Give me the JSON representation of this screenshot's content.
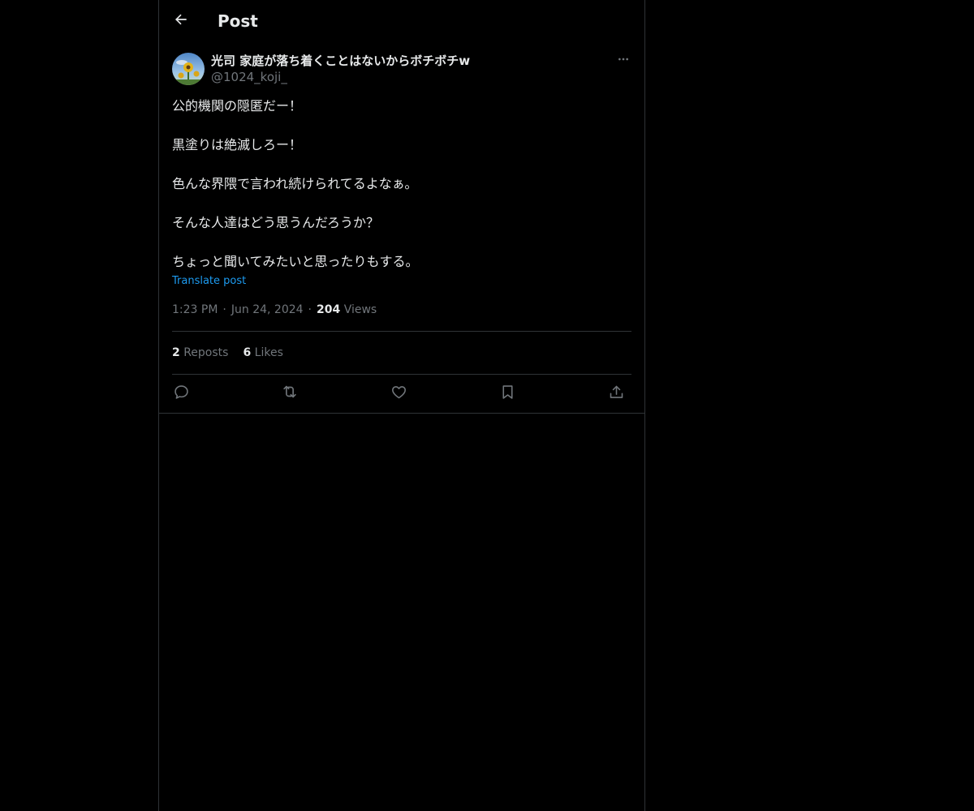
{
  "header": {
    "title": "Post"
  },
  "author": {
    "display_name": "光司 家庭が落ち着くことはないからボチボチw",
    "handle": "@1024_koji_"
  },
  "post": {
    "lines": [
      "公的機関の隠匿だー！",
      "黒塗りは絶滅しろー！",
      "色んな界隈で言われ続けられてるよなぁ。",
      "そんな人達はどう思うんだろうか？",
      "ちょっと聞いてみたいと思ったりもする。"
    ],
    "translate_label": "Translate post",
    "time": "1:23 PM",
    "date": "Jun 24, 2024",
    "views_count": "204",
    "views_label": "Views",
    "meta_separator": "·"
  },
  "stats": {
    "reposts_count": "2",
    "reposts_label": "Reposts",
    "likes_count": "6",
    "likes_label": "Likes"
  },
  "icons": {
    "back": "arrow-left-icon",
    "more": "more-horizontal-icon",
    "reply": "reply-icon",
    "repost": "repost-icon",
    "like": "heart-icon",
    "bookmark": "bookmark-icon",
    "share": "share-icon"
  },
  "colors": {
    "background": "#000000",
    "text": "#e7e9ea",
    "secondary": "#71767b",
    "accent": "#1d9bf0",
    "border": "#2f3336"
  }
}
